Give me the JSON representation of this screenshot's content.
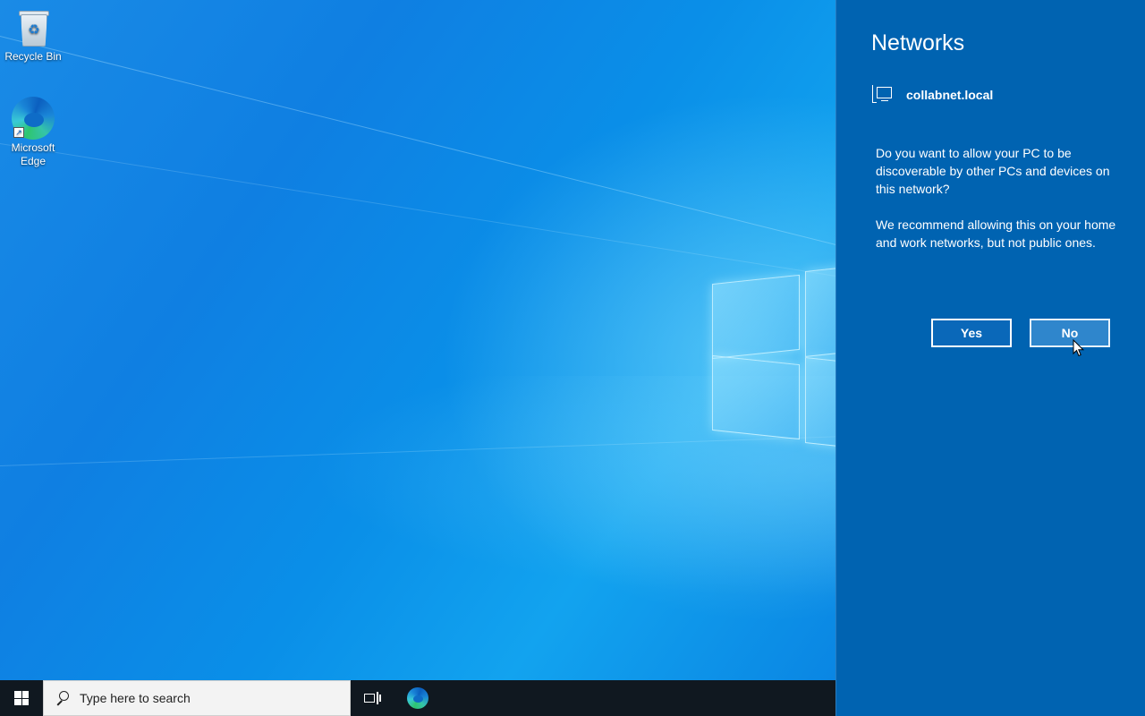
{
  "desktop": {
    "icons": [
      {
        "label": "Recycle Bin",
        "icon": "recycle-bin-icon"
      },
      {
        "label": "Microsoft Edge",
        "icon": "edge-icon"
      }
    ]
  },
  "flyout": {
    "title": "Networks",
    "network_name": "collabnet.local",
    "question": "Do you want to allow your PC to be discoverable by other PCs and devices on this network?",
    "recommendation": "We recommend allowing this on your home and work networks, but not public ones.",
    "yes_label": "Yes",
    "no_label": "No",
    "background_color": "#0063b1"
  },
  "taskbar": {
    "search_placeholder": "Type here to search",
    "icons": [
      "windows-start-icon",
      "search-icon",
      "task-view-icon",
      "edge-icon"
    ]
  }
}
